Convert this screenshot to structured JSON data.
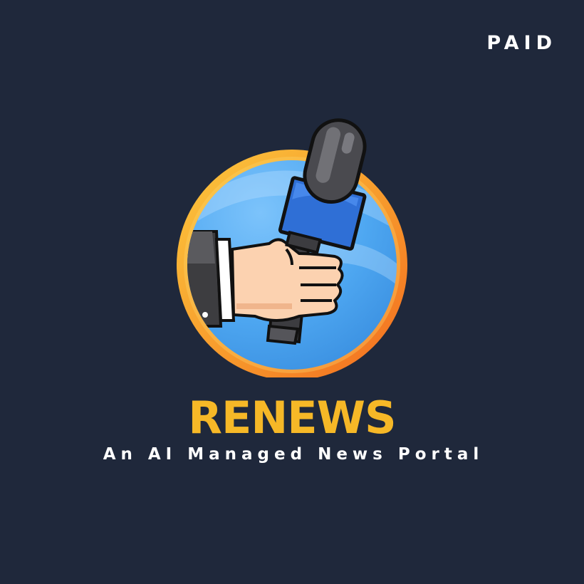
{
  "badge": "PAID",
  "brand": {
    "name": "RENEWS",
    "tagline": "An AI Managed News Portal"
  },
  "colors": {
    "background": "#1f283b",
    "brand_text": "#f6b827",
    "ring_outer": "#f47a22",
    "ring_inner": "#f9c03a",
    "disc_blue": "#4fa7f0",
    "mic_body": "#2f6fd6",
    "skin": "#fcd2b0"
  },
  "icons": {
    "logo": "hand-holding-microphone-icon"
  }
}
